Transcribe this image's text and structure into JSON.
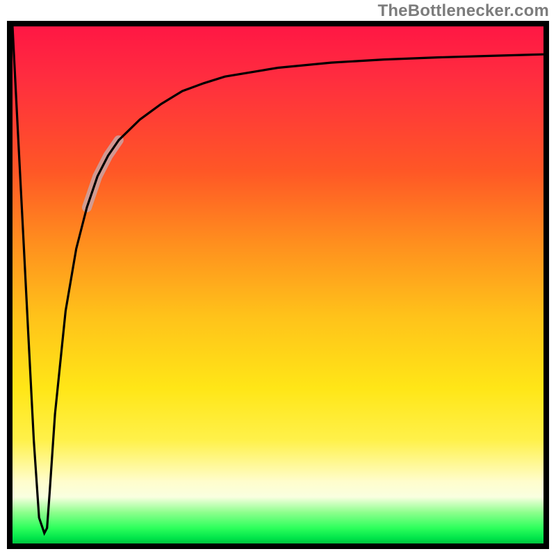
{
  "watermark": "TheBottlenecker.com",
  "colors": {
    "frame": "#000000",
    "curve": "#000000",
    "highlight": "#caa3a3",
    "gradient_stops": [
      "#ff1744",
      "#ff5726",
      "#ffc21a",
      "#fff14a",
      "#2dff5c",
      "#00c43e"
    ]
  },
  "chart_data": {
    "type": "line",
    "title": "",
    "xlabel": "",
    "ylabel": "",
    "xlim": [
      0,
      100
    ],
    "ylim": [
      0,
      100
    ],
    "series": [
      {
        "name": "bottleneck-curve",
        "x": [
          0,
          1,
          2,
          3,
          4,
          5,
          6,
          6.5,
          7,
          8,
          10,
          12,
          14,
          16,
          18,
          20,
          24,
          28,
          32,
          36,
          40,
          50,
          60,
          70,
          80,
          90,
          100
        ],
        "values": [
          100,
          80,
          60,
          40,
          20,
          5,
          2,
          3,
          10,
          25,
          45,
          57,
          65,
          71,
          75,
          78,
          82,
          85,
          87.5,
          89,
          90.3,
          92,
          93,
          93.6,
          94,
          94.3,
          94.6
        ]
      }
    ],
    "annotations": [
      {
        "name": "curve-highlight",
        "x_range": [
          14,
          20
        ],
        "note": "faint pink thick segment overlaying curve"
      }
    ]
  }
}
